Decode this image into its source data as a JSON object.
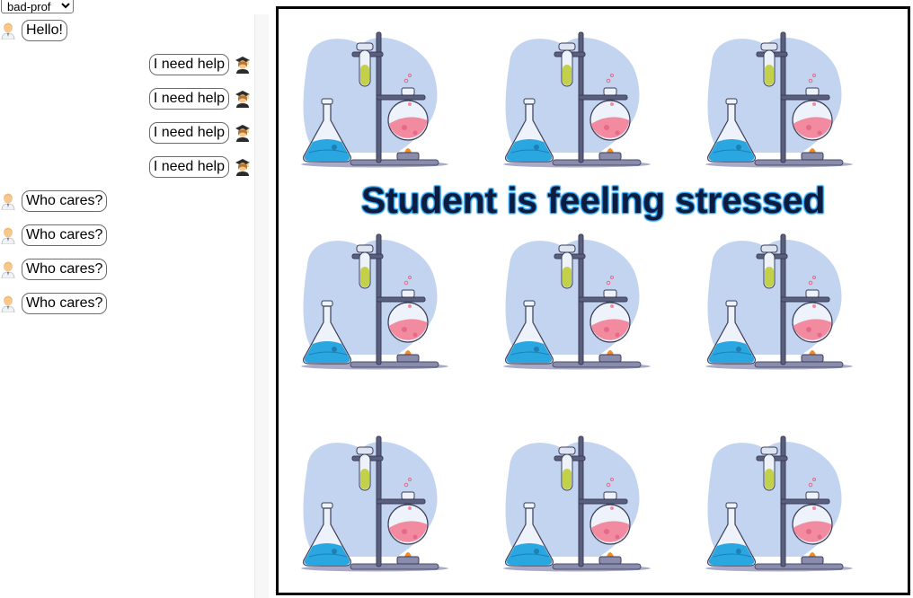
{
  "scenario_select": {
    "selected": "bad-prof"
  },
  "messages": [
    {
      "role": "professor",
      "text": "Hello!"
    },
    {
      "role": "student",
      "text": "I need help"
    },
    {
      "role": "student",
      "text": "I need help"
    },
    {
      "role": "student",
      "text": "I need help"
    },
    {
      "role": "student",
      "text": "I need help"
    },
    {
      "role": "professor",
      "text": "Who cares?"
    },
    {
      "role": "professor",
      "text": "Who cares?"
    },
    {
      "role": "professor",
      "text": "Who cares?"
    },
    {
      "role": "professor",
      "text": "Who cares?"
    }
  ],
  "canvas": {
    "banner": "Student is feeling stressed",
    "illustration": "chemistry-lab-icon",
    "tile_rows": 3,
    "tile_cols": 3
  },
  "colors": {
    "banner_text": "#0d1b3e",
    "banner_outline": "#29a3f0",
    "blob": "#c2d4ef",
    "flask_liquid": "#2aa6e0",
    "round_flask_liquid": "#f28ba0",
    "stand": "#5a5f7e"
  }
}
